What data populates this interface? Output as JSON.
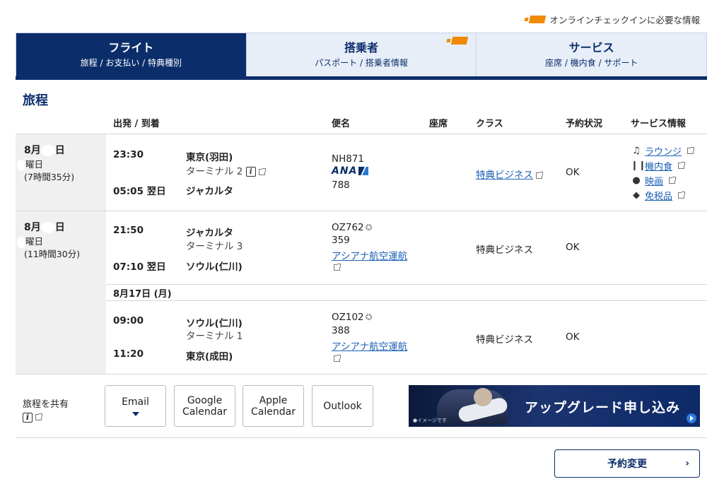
{
  "top_note": "オンラインチェックインに必要な情報",
  "tabs": [
    {
      "title": "フライト",
      "sub": "旅程 / お支払い / 特典種別"
    },
    {
      "title": "搭乗者",
      "sub": "パスポート / 搭乗者情報"
    },
    {
      "title": "サービス",
      "sub": "座席 / 機内食 / サポート"
    }
  ],
  "section_title": "旅程",
  "headers": {
    "dep_arr": "出発 / 到着",
    "flight": "便名",
    "seat": "座席",
    "class": "クラス",
    "status": "予約状況",
    "service": "サービス情報"
  },
  "segments": [
    {
      "date_month": "8月",
      "date_day_suffix": "日",
      "weekday_suffix": "曜日",
      "duration": "(7時間35分)",
      "dep_time": "23:30",
      "dep_city": "東京(羽田)",
      "dep_terminal": "ターミナル 2",
      "arr_time": "05:05 翌日",
      "arr_city": "ジャカルタ",
      "flight_no": "NH871",
      "airline_logo": "ANA",
      "aircraft": "788",
      "class": "特典ビジネス",
      "status": "OK",
      "services": [
        "ラウンジ",
        "機内食",
        "映画",
        "免税品"
      ]
    },
    {
      "date_month": "8月",
      "date_day_suffix": "日",
      "weekday_suffix": "曜日",
      "duration": "(11時間30分)",
      "dep_time": "21:50",
      "dep_city": "ジャカルタ",
      "dep_terminal": "ターミナル 3",
      "arr_time": "07:10 翌日",
      "arr_city": "ソウル(仁川)",
      "flight_no": "OZ762",
      "aircraft": "359",
      "operator": "アシアナ航空運航",
      "class": "特典ビジネス",
      "status": "OK"
    },
    {
      "sub_date": "8月17日 (月)",
      "dep_time": "09:00",
      "dep_city": "ソウル(仁川)",
      "dep_terminal": "ターミナル 1",
      "arr_time": "11:20",
      "arr_city": "東京(成田)",
      "flight_no": "OZ102",
      "aircraft": "388",
      "operator": "アシアナ航空運航",
      "class": "特典ビジネス",
      "status": "OK"
    }
  ],
  "share": {
    "label": "旅程を共有",
    "buttons": {
      "email": "Email",
      "google_1": "Google",
      "google_2": "Calendar",
      "apple_1": "Apple",
      "apple_2": "Calendar",
      "outlook": "Outlook"
    }
  },
  "banner": {
    "text": "アップグレード申し込み",
    "note": "●イメージです"
  },
  "change_button": "予約変更",
  "icons": {
    "ticket": "ticket-icon",
    "info": "info-icon",
    "external": "external-link-icon",
    "star": "star-alliance-icon",
    "lounge": "lounge-icon",
    "meal": "meal-icon",
    "movie": "movie-icon",
    "dutyfree": "duty-free-icon"
  },
  "colors": {
    "brand_navy": "#0b2e6b",
    "tab_inactive": "#e8eef8",
    "link": "#1a5fb4",
    "accent_orange": "#f08a00"
  }
}
